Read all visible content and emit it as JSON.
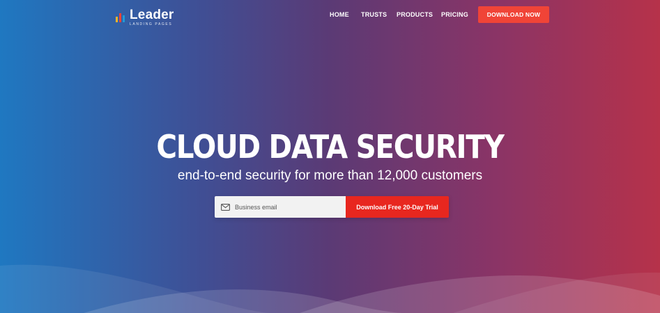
{
  "brand": {
    "name": "Leader",
    "tagline": "LANDING PAGES",
    "logo_colors": [
      "#f0b429",
      "#e8271f",
      "#1f9bd7",
      "#f04437"
    ]
  },
  "nav": {
    "items": [
      {
        "label": "HOME"
      },
      {
        "label": "TRUSTS"
      },
      {
        "label": "PRODUCTS"
      },
      {
        "label": "PRICING"
      }
    ],
    "cta_label": "DOWNLOAD NOW"
  },
  "hero": {
    "title": "CLOUD DATA SECURITY",
    "subtitle": "end-to-end security for more than 12,000 customers"
  },
  "signup": {
    "email_placeholder": "Business email",
    "email_value": "",
    "button_label": "Download Free 20-Day Trial"
  },
  "icons": {
    "email": "mail-icon"
  },
  "colors": {
    "accent": "#f04437",
    "cta": "#e8271f",
    "gradient_left": "#1f78c1",
    "gradient_right": "#b6324a"
  }
}
